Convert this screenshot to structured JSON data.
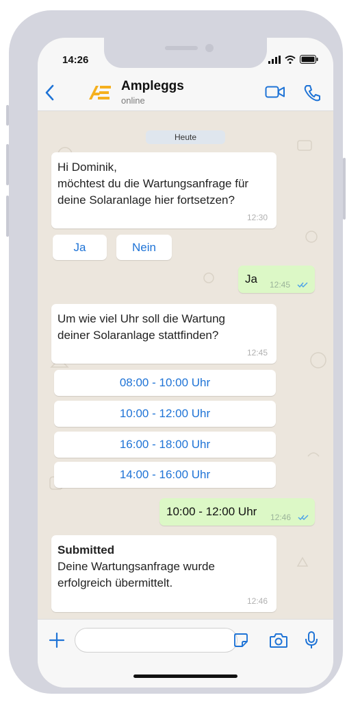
{
  "status_bar": {
    "time": "14:26"
  },
  "header": {
    "contact_name": "Ampleggs",
    "presence": "online"
  },
  "chat": {
    "date_chip": "Heute",
    "message_1": {
      "text": "Hi Dominik,\nmöchtest du die Wartungsanfrage für\ndeine Solaranlage hier fortsetzen?",
      "time": "12:30"
    },
    "quick_replies_1": [
      "Ja",
      "Nein"
    ],
    "reply_1": {
      "text": "Ja",
      "time": "12:45"
    },
    "message_2": {
      "text": "Um wie viel Uhr soll die Wartung\ndeiner Solaranlage stattfinden?",
      "time": "12:45"
    },
    "time_options": [
      "08:00 - 10:00 Uhr",
      "10:00 - 12:00 Uhr",
      "16:00 - 18:00 Uhr",
      "14:00 - 16:00 Uhr"
    ],
    "reply_2": {
      "text": "10:00 - 12:00 Uhr",
      "time": "12:46"
    },
    "message_3": {
      "title": "Submitted",
      "text": "Deine Wartungsanfrage wurde\nerfolgreich übermittelt.",
      "time": "12:46"
    }
  },
  "colors": {
    "accent": "#1e73d6",
    "outgoing": "#dcf8c6",
    "chat_bg": "#ece6dd",
    "logo": "#f5b01e"
  },
  "icons": [
    "back-chevron-icon",
    "ampleggs-logo-icon",
    "video-call-icon",
    "phone-icon",
    "plus-icon",
    "sticker-icon",
    "camera-icon",
    "microphone-icon",
    "double-check-icon",
    "signal-icon",
    "wifi-icon",
    "battery-icon"
  ]
}
